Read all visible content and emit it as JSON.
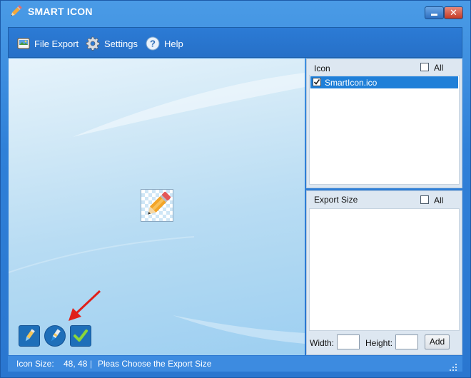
{
  "window": {
    "title": "SMART ICON",
    "minimize_glyph": "▬",
    "close_glyph": "✕"
  },
  "toolbar": {
    "items": [
      {
        "label": "File Export",
        "icon": "file-export-icon"
      },
      {
        "label": "Settings",
        "icon": "gear-icon"
      },
      {
        "label": "Help",
        "icon": "help-icon"
      }
    ]
  },
  "icon_panel": {
    "title": "Icon",
    "all_label": "All",
    "all_checked": false,
    "items": [
      {
        "label": "SmartIcon.ico",
        "checked": true,
        "selected": true
      }
    ]
  },
  "export_panel": {
    "title": "Export Size",
    "all_label": "All",
    "all_checked": false,
    "width_label": "Width:",
    "height_label": "Height:",
    "width_value": "",
    "height_value": "",
    "add_label": "Add"
  },
  "preview_buttons": [
    {
      "name": "pencil-tool-button",
      "icon": "pencil-icon"
    },
    {
      "name": "brush-tool-button",
      "icon": "brush-icon"
    },
    {
      "name": "apply-button",
      "icon": "checkmark-icon"
    }
  ],
  "status": {
    "icon_size_label": "Icon Size:",
    "icon_size_value": "48, 48",
    "separator": "|",
    "message": "Pleas Choose the Export Size"
  },
  "colors": {
    "window_blue": "#2f80d8",
    "selection_blue": "#1f7fd8",
    "arrow_red": "#e0201a"
  }
}
